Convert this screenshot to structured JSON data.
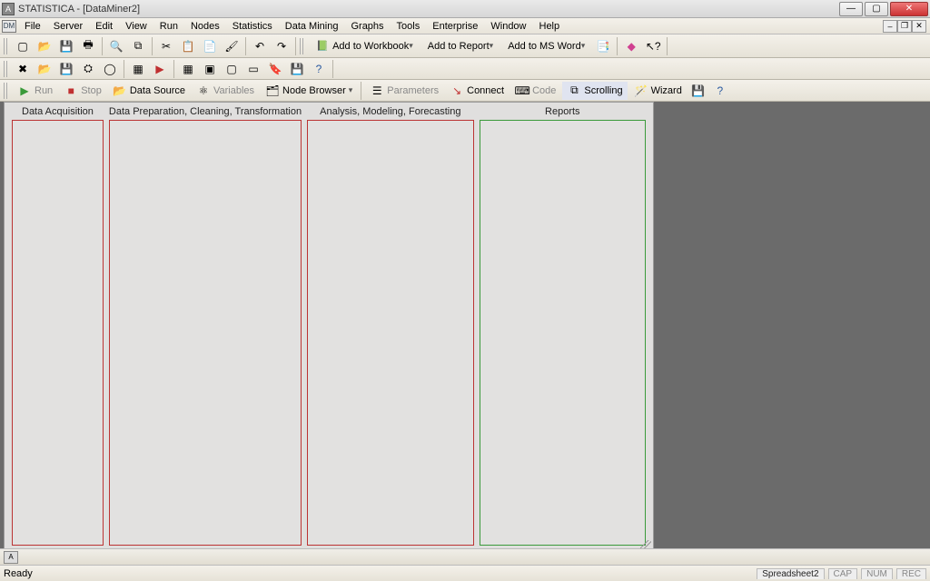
{
  "title": "STATISTICA - [DataMiner2]",
  "menus": [
    "File",
    "Server",
    "Edit",
    "View",
    "Run",
    "Nodes",
    "Statistics",
    "Data Mining",
    "Graphs",
    "Tools",
    "Enterprise",
    "Window",
    "Help"
  ],
  "toolbar_add": {
    "workbook": "Add to Workbook",
    "report": "Add to Report",
    "msword": "Add to MS Word"
  },
  "toolbar3": {
    "run": "Run",
    "stop": "Stop",
    "data_source": "Data Source",
    "variables": "Variables",
    "node_browser": "Node Browser",
    "parameters": "Parameters",
    "connect": "Connect",
    "code": "Code",
    "scrolling": "Scrolling",
    "wizard": "Wizard"
  },
  "columns": [
    {
      "title": "Data Acquisition",
      "color": "red"
    },
    {
      "title": "Data Preparation, Cleaning, Transformation",
      "color": "red"
    },
    {
      "title": "Analysis, Modeling, Forecasting",
      "color": "red"
    },
    {
      "title": "Reports",
      "color": "green"
    }
  ],
  "status": {
    "ready": "Ready",
    "doc": "Spreadsheet2",
    "cap": "CAP",
    "num": "NUM",
    "rec": "REC"
  }
}
